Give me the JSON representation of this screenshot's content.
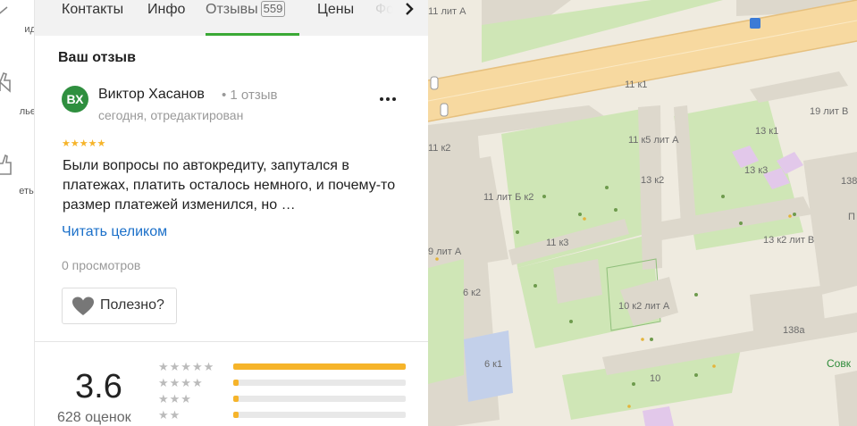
{
  "rail": {
    "items": [
      {
        "label": "ид",
        "icon": "route-icon"
      },
      {
        "label": "лье",
        "icon": "hand-icon"
      },
      {
        "label": "еты",
        "icon": "thumbs-up-icon"
      }
    ]
  },
  "tabs": [
    {
      "label": "Контакты"
    },
    {
      "label": "Инфо"
    },
    {
      "label": "Отзывы",
      "count": "559",
      "active": true
    },
    {
      "label": "Цены"
    },
    {
      "label": "Фо"
    }
  ],
  "review": {
    "section_title": "Ваш отзыв",
    "avatar_initials": "ВХ",
    "author": "Виктор Хасанов",
    "author_reviews": "1 отзыв",
    "date": "сегодня, отредактирован",
    "stars": 5,
    "text": "Были вопросы по автокредиту, запутался в платежах, платить осталось немного, и почему-то размер платежей изменился, но …",
    "read_more": "Читать целиком",
    "views": "0 просмотров",
    "useful_label": "Полезно?"
  },
  "rating": {
    "value": "3.6",
    "count_label": "628 оценок",
    "distribution": [
      {
        "stars": 5,
        "fraction": 1.0
      },
      {
        "stars": 4,
        "fraction": 0.02
      },
      {
        "stars": 3,
        "fraction": 0.02
      },
      {
        "stars": 2,
        "fraction": 0.03
      }
    ]
  },
  "map": {
    "labels": [
      "11 лит А",
      "11 к1",
      "19 лит В",
      "11 к5 лит А",
      "13 к1",
      "11 к2",
      "13 к3",
      "11 лит Б к2",
      "13 к2",
      "138",
      "П",
      "13 к2 лит В",
      "11 к3",
      "9 лит А",
      "6 к2",
      "10 к2 лит А",
      "138а",
      "6 к1",
      "10",
      "Совк"
    ],
    "colors": {
      "land": "#efebe0",
      "park": "#cfe6b6",
      "road": "#f7d9a0",
      "building": "#ddd8cc",
      "kindergarten": "#e2c8ea",
      "school": "#c3d0ea"
    }
  }
}
